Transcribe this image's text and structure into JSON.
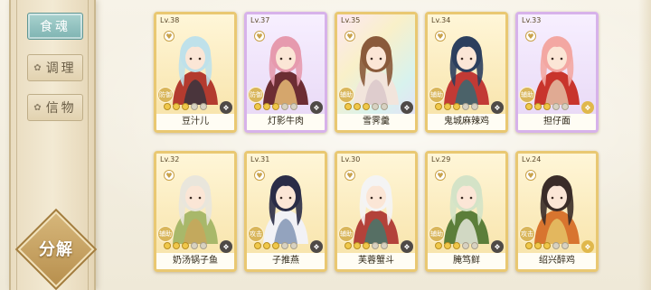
{
  "sidebar": {
    "tabs": [
      {
        "label": "食魂",
        "active": true
      },
      {
        "label": "调理",
        "active": false
      },
      {
        "label": "信物",
        "active": false
      }
    ],
    "decompose_label": "分解"
  },
  "cards": [
    {
      "level": "Lv.38",
      "role": "防御",
      "name": "豆汁儿",
      "stars": 3,
      "frame": "gold",
      "elem": "dark",
      "palette": [
        "#bfe1ea",
        "#b33b2f",
        "#2f3440"
      ]
    },
    {
      "level": "Lv.37",
      "role": "防御",
      "name": "灯影牛肉",
      "stars": 3,
      "frame": "purple",
      "elem": "dark",
      "palette": [
        "#e69aae",
        "#6c2d33",
        "#f0c47a"
      ]
    },
    {
      "level": "Lv.35",
      "role": "辅助",
      "name": "雪霁羹",
      "stars": 3,
      "frame": "shimmer",
      "elem": "dark",
      "palette": [
        "#8a5a3b",
        "#f2e5dc",
        "#d8c6c9"
      ]
    },
    {
      "level": "Lv.34",
      "role": "辅助",
      "name": "鬼城麻辣鸡",
      "stars": 3,
      "frame": "gold",
      "elem": "dark",
      "palette": [
        "#2c3f5e",
        "#c23a35",
        "#2d6d77"
      ]
    },
    {
      "level": "Lv.33",
      "role": "辅助",
      "name": "担仔面",
      "stars": 3,
      "frame": "purple",
      "elem": "gold",
      "palette": [
        "#f3a7a2",
        "#c8342c",
        "#e6c8ae"
      ]
    },
    {
      "level": "Lv.32",
      "role": "辅助",
      "name": "奶汤锅子鱼",
      "stars": 3,
      "frame": "gold",
      "elem": "dark",
      "palette": [
        "#e9e6dc",
        "#a8b86a",
        "#c9a55a"
      ]
    },
    {
      "level": "Lv.31",
      "role": "攻击",
      "name": "子推燕",
      "stars": 3,
      "frame": "gold",
      "elem": "dark",
      "palette": [
        "#2a2c47",
        "#f2f2f6",
        "#7a8fb0"
      ]
    },
    {
      "level": "Lv.30",
      "role": "辅助",
      "name": "芙蓉蟹斗",
      "stars": 3,
      "frame": "gold",
      "elem": "dark",
      "palette": [
        "#f4f4f4",
        "#b3423a",
        "#3f7a6f"
      ]
    },
    {
      "level": "Lv.29",
      "role": "辅助",
      "name": "腌笃鲜",
      "stars": 3,
      "frame": "gold",
      "elem": "dark",
      "palette": [
        "#d4e3c7",
        "#5c7e3a",
        "#efefe6"
      ]
    },
    {
      "level": "Lv.24",
      "role": "攻击",
      "name": "绍兴醉鸡",
      "stars": 3,
      "frame": "gold",
      "elem": "gold",
      "palette": [
        "#3a2c28",
        "#d8752f",
        "#e6c86a"
      ]
    }
  ]
}
